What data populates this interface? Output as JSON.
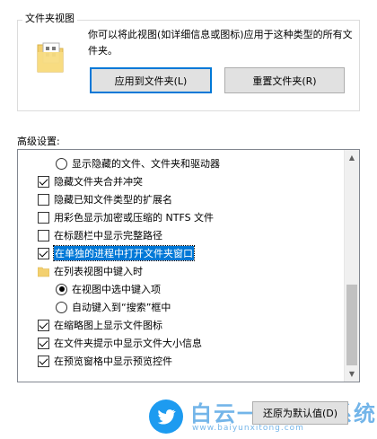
{
  "folder_views": {
    "group_title": "文件夹视图",
    "description": "你可以将此视图(如详细信息或图标)应用于这种类型的所有文件夹。",
    "apply_button": "应用到文件夹(L)",
    "reset_button": "重置文件夹(R)"
  },
  "advanced": {
    "label": "高级设置:",
    "items": [
      {
        "type": "radio",
        "checked": false,
        "indent": 1,
        "label": "显示隐藏的文件、文件夹和驱动器"
      },
      {
        "type": "checkbox",
        "checked": true,
        "indent": 0,
        "label": "隐藏文件夹合并冲突"
      },
      {
        "type": "checkbox",
        "checked": false,
        "indent": 0,
        "label": "隐藏已知文件类型的扩展名"
      },
      {
        "type": "checkbox",
        "checked": false,
        "indent": 0,
        "label": "用彩色显示加密或压缩的 NTFS 文件"
      },
      {
        "type": "checkbox",
        "checked": false,
        "indent": 0,
        "label": "在标题栏中显示完整路径"
      },
      {
        "type": "checkbox",
        "checked": true,
        "indent": 0,
        "label": "在单独的进程中打开文件夹窗口",
        "selected": true
      },
      {
        "type": "folder",
        "checked": false,
        "indent": 0,
        "label": "在列表视图中键入时"
      },
      {
        "type": "radio",
        "checked": true,
        "indent": 1,
        "label": "在视图中选中键入项"
      },
      {
        "type": "radio",
        "checked": false,
        "indent": 1,
        "label": "自动键入到“搜索”框中"
      },
      {
        "type": "checkbox",
        "checked": true,
        "indent": 0,
        "label": "在缩略图上显示文件图标"
      },
      {
        "type": "checkbox",
        "checked": true,
        "indent": 0,
        "label": "在文件夹提示中显示文件大小信息"
      },
      {
        "type": "checkbox",
        "checked": true,
        "indent": 0,
        "label": "在预览窗格中显示预览控件"
      }
    ],
    "restore_button": "还原为默认值(D)"
  },
  "watermark": {
    "text": "白云一键重装系统",
    "url": "www.baiyunxitong.com"
  },
  "colors": {
    "selection": "#0078d7",
    "button_face": "#e1e1e1"
  }
}
